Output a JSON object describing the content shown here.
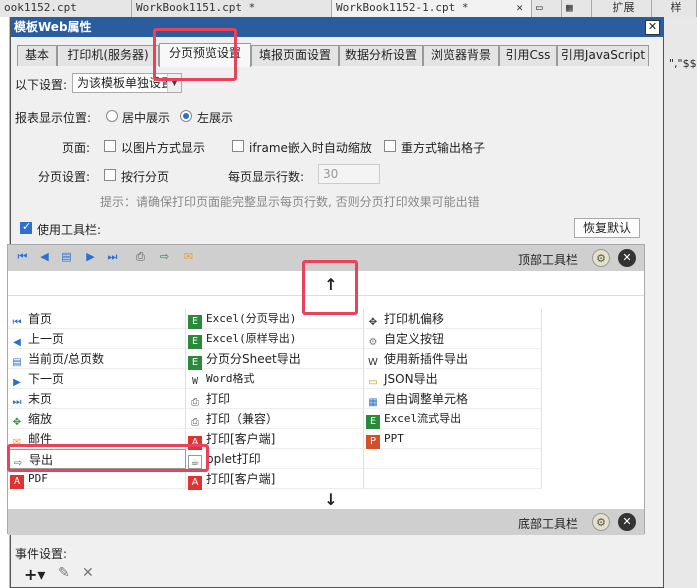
{
  "editor_tabs": [
    {
      "label": "ook1152.cpt"
    },
    {
      "label": "WorkBook1151.cpt *"
    },
    {
      "label": "WorkBook1152-1.cpt *"
    }
  ],
  "right_panel": {
    "tab1": "扩展",
    "tab2": "样",
    "snippet": "\",\"$$"
  },
  "dialog": {
    "title": "模板Web属性",
    "close": "✕",
    "tabs": [
      "基本",
      "打印机(服务器)",
      "分页预览设置",
      "填报页面设置",
      "数据分析设置",
      "浏览器背景",
      "引用Css",
      "引用JavaScript"
    ],
    "active_tab": 2
  },
  "settings": {
    "scope_label": "以下设置:",
    "scope_value": "为该模板单独设置",
    "position_label": "报表显示位置:",
    "position_center": "居中展示",
    "position_left": "左展示",
    "page_label": "页面:",
    "opt_image_print": "以图片方式显示",
    "opt_iframe": "iframe嵌入时自动缩放",
    "opt_repeat": "重方式输出格子",
    "paging_label": "分页设置:",
    "opt_row_paging": "按行分页",
    "rows_label": "每页显示行数:",
    "rows_value": "30",
    "hint": "提示：请确保打印页面能完整显示每页行数, 否则分页打印效果可能出错",
    "use_toolbar": "使用工具栏:",
    "restore": "恢复默认"
  },
  "toolbar": {
    "top_label": "顶部工具栏",
    "bottom_label": "底部工具栏",
    "move_up": "↑",
    "move_down": "↓",
    "icons": [
      "first-page-icon",
      "prev-page-icon",
      "page-counter-icon",
      "next-page-icon",
      "last-page-icon",
      "print-icon",
      "export-icon",
      "email-icon"
    ]
  },
  "items": {
    "col1": [
      "首页",
      "上一页",
      "当前页/总页数",
      "下一页",
      "末页",
      "缩放",
      "邮件",
      "导出",
      "PDF"
    ],
    "col2": [
      "Excel(分页导出)",
      "Excel(原样导出)",
      "分页分Sheet导出",
      "Word格式",
      "打印",
      "打印（兼容）",
      "打印[客户端]",
      "pplet打印",
      "打印[客户端]"
    ],
    "col3": [
      "打印机偏移",
      "自定义按钮",
      "使用新插件导出",
      "JSON导出",
      "自由调整单元格",
      "Excel流式导出",
      "PPT"
    ]
  },
  "events": {
    "label": "事件设置:"
  },
  "colors": {
    "titlebar": "#2b5d9e",
    "highlight": "#e8435a",
    "accent": "#2c6fd1"
  }
}
